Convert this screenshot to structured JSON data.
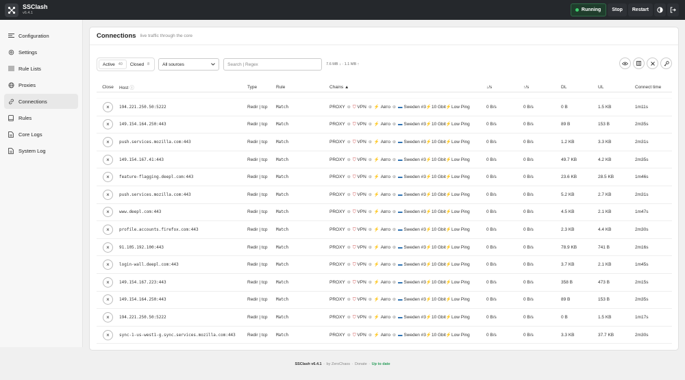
{
  "header": {
    "app_name": "SSClash",
    "version": "v6.4.1",
    "status": "Running",
    "stop_label": "Stop",
    "restart_label": "Restart"
  },
  "sidebar": {
    "items": [
      {
        "label": "Configuration",
        "icon": "sliders-icon"
      },
      {
        "label": "Settings",
        "icon": "gear-icon"
      },
      {
        "label": "Rule Lists",
        "icon": "list-icon"
      },
      {
        "label": "Proxies",
        "icon": "globe-icon"
      },
      {
        "label": "Connections",
        "icon": "link-icon",
        "active": true
      },
      {
        "label": "Rules",
        "icon": "book-icon"
      },
      {
        "label": "Core Logs",
        "icon": "file-icon"
      },
      {
        "label": "System Log",
        "icon": "file-icon"
      }
    ]
  },
  "page": {
    "title": "Connections",
    "subtitle": "live traffic through the core"
  },
  "toolbar": {
    "active_label": "Active",
    "active_count": "40",
    "closed_label": "Closed",
    "closed_count": "8",
    "source_select": "All sources",
    "search_placeholder": "Search | Regex",
    "traffic_summary": "7.6 MB ↓ · 1.1 MB ↑"
  },
  "table": {
    "headers": {
      "close": "Close",
      "host": "Host",
      "type": "Type",
      "rule": "Rule",
      "chains": "Chains ▲",
      "down_rate": "↓/s",
      "up_rate": "↑/s",
      "dl": "DL",
      "ul": "UL",
      "connect_time": "Connect time"
    },
    "chain": {
      "proxy": "PROXY",
      "vpn": "VPN",
      "auto": "Авто",
      "node": "Sweden #3",
      "speed": "10 Gbit",
      "tag": "Low Ping"
    },
    "rows": [
      {
        "host": "194.221.250.50:5222",
        "type": "Redir | tcp",
        "rule": "Match",
        "down": "0 B/s",
        "up": "0 B/s",
        "dl": "0 B",
        "ul": "1.5 KB",
        "time": "1m11s"
      },
      {
        "host": "149.154.164.250:443",
        "type": "Redir | tcp",
        "rule": "Match",
        "down": "0 B/s",
        "up": "0 B/s",
        "dl": "89 B",
        "ul": "153 B",
        "time": "2m35s"
      },
      {
        "host": "push.services.mozilla.com:443",
        "type": "Redir | tcp",
        "rule": "Match",
        "down": "0 B/s",
        "up": "0 B/s",
        "dl": "1.2 KB",
        "ul": "3.3 KB",
        "time": "2m31s"
      },
      {
        "host": "149.154.167.41:443",
        "type": "Redir | tcp",
        "rule": "Match",
        "down": "0 B/s",
        "up": "0 B/s",
        "dl": "49.7 KB",
        "ul": "4.2 KB",
        "time": "2m35s"
      },
      {
        "host": "feature-flagging.deepl.com:443",
        "type": "Redir | tcp",
        "rule": "Match",
        "down": "0 B/s",
        "up": "0 B/s",
        "dl": "23.6 KB",
        "ul": "28.5 KB",
        "time": "1m46s"
      },
      {
        "host": "push.services.mozilla.com:443",
        "type": "Redir | tcp",
        "rule": "Match",
        "down": "0 B/s",
        "up": "0 B/s",
        "dl": "5.2 KB",
        "ul": "2.7 KB",
        "time": "2m31s"
      },
      {
        "host": "www.deepl.com:443",
        "type": "Redir | tcp",
        "rule": "Match",
        "down": "0 B/s",
        "up": "0 B/s",
        "dl": "4.5 KB",
        "ul": "2.1 KB",
        "time": "1m47s"
      },
      {
        "host": "profile.accounts.firefox.com:443",
        "type": "Redir | tcp",
        "rule": "Match",
        "down": "0 B/s",
        "up": "0 B/s",
        "dl": "2.3 KB",
        "ul": "4.4 KB",
        "time": "2m30s"
      },
      {
        "host": "91.105.192.100:443",
        "type": "Redir | tcp",
        "rule": "Match",
        "down": "0 B/s",
        "up": "0 B/s",
        "dl": "78.9 KB",
        "ul": "741 B",
        "time": "2m16s"
      },
      {
        "host": "login-wall.deepl.com:443",
        "type": "Redir | tcp",
        "rule": "Match",
        "down": "0 B/s",
        "up": "0 B/s",
        "dl": "3.7 KB",
        "ul": "2.1 KB",
        "time": "1m45s"
      },
      {
        "host": "149.154.167.223:443",
        "type": "Redir | tcp",
        "rule": "Match",
        "down": "0 B/s",
        "up": "0 B/s",
        "dl": "358 B",
        "ul": "473 B",
        "time": "2m15s"
      },
      {
        "host": "149.154.164.250:443",
        "type": "Redir | tcp",
        "rule": "Match",
        "down": "0 B/s",
        "up": "0 B/s",
        "dl": "89 B",
        "ul": "153 B",
        "time": "2m35s"
      },
      {
        "host": "194.221.250.50:5222",
        "type": "Redir | tcp",
        "rule": "Match",
        "down": "0 B/s",
        "up": "0 B/s",
        "dl": "0 B",
        "ul": "1.5 KB",
        "time": "1m17s"
      },
      {
        "host": "sync-1-us-west1-g.sync.services.mozilla.com:443",
        "type": "Redir | tcp",
        "rule": "Match",
        "down": "0 B/s",
        "up": "0 B/s",
        "dl": "3.3 KB",
        "ul": "37.7 KB",
        "time": "2m30s"
      }
    ]
  },
  "footer": {
    "name": "SSClash v6.4.1",
    "by": "by ZeroChaos",
    "donate": "Donate",
    "status": "Up to date"
  }
}
